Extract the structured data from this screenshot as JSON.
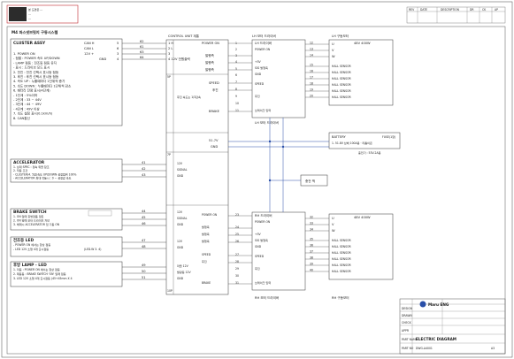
{
  "title_stamp": {
    "line1": "본 도면은 ...",
    "line2": "...",
    "line3": "..."
  },
  "page_title": "M4 파스넷브릿지 구동시스템",
  "revision_header": [
    "REV",
    "DATE",
    "DESCRIPTION",
    "DR",
    "CK",
    "AP"
  ],
  "cluster": {
    "title": "CLUSTER ASSY",
    "pins": [
      {
        "label": "CAN H",
        "pin": "5"
      },
      {
        "label": "CAN L",
        "pin": "6"
      },
      {
        "label": "12V +",
        "pin": "3"
      },
      {
        "label": "GND",
        "pin": "4"
      }
    ],
    "notes": [
      "1. POWER ON",
      "- 점멸 : POWER 속도 UP/DOWN",
      "- LAMP 점등 : 전조등 점등 유지",
      "- 표시 : 드라이브 모드 표시",
      "2. 전진 : 전진 선택시 표시등 점등",
      "3. 후진 : 후진 선택시 표시등 점등",
      "4. 속도 UP : 누를때마다 1단위씩 증가",
      "5. 속도 DOWN : 누를때마다 1단위씩 감소",
      "6. 배터리 잔량 표시(4단계)",
      "- 1단계 : 5%이하",
      "- 2단계 : 33 ~ 44V",
      "- 3단계 : 44 ~ 49V",
      "- 4단계 : 49V 이상",
      "7. 속도 설정 표시(0.1km/h)",
      "8. CAN통신"
    ]
  },
  "control_unit": {
    "title": "CONTROL UNIT 계통",
    "left_pins": [
      "1 H",
      "2 L",
      "3",
      "4 12V 전원출력",
      "5",
      "6",
      "7",
      "8",
      "9",
      "10",
      "11"
    ],
    "connector_left": [
      "62",
      "61",
      "63",
      "64"
    ],
    "motor_labels": [
      "POWER ON",
      "발행측",
      "발행측",
      "발행측",
      "SPEED",
      "후진",
      "BRAKE"
    ],
    "note": "후진 속도는 1/3감속",
    "batt_labels": [
      "51.7V",
      "GND"
    ],
    "bottom_labels": [
      "12V",
      "SIGNAL",
      "GND",
      "12V",
      "SIGNAL",
      "GND",
      "12V",
      "GND",
      "POWER ON",
      "발행측",
      "발행측",
      "발행측",
      "SPEED",
      "후진",
      "BRAKE",
      "마을 12V",
      "발광등 12V",
      "GND"
    ],
    "pin_group_a": "5P",
    "pin_group_b": "7P",
    "pin_group_c": "10P"
  },
  "lh_driver": {
    "title": "LH 모터 드라이버",
    "inner_title": "LH 드라이버",
    "rows": [
      "POWER ON",
      "+5V",
      "SIG 발행측",
      "GND",
      "SPEED",
      "후진",
      "브레이크 입력"
    ],
    "pins": [
      "1",
      "2",
      "3",
      "4",
      "5",
      "6",
      "7",
      "8",
      "9",
      "10",
      "11"
    ]
  },
  "lh_motor": {
    "title": "LH 구동모터",
    "phases": [
      {
        "pin": "12",
        "label": "U"
      },
      {
        "pin": "13",
        "label": "V"
      },
      {
        "pin": "14",
        "label": "W"
      }
    ],
    "spec": "48V 400W",
    "sensors": [
      "HALL SENSOR",
      "HALL SENSOR",
      "HALL SENSOR",
      "HALL SENSOR",
      "HALL SENSOR",
      "HALL SENSOR"
    ],
    "sensor_pins": [
      "15",
      "16",
      "17",
      "18",
      "19",
      "20"
    ]
  },
  "rh_driver": {
    "title": "RH 모터 드라이버",
    "inner_title": "RH 드라이버",
    "rows": [
      "POWER ON",
      "+5V",
      "SIG 발행측",
      "GND",
      "SPEED",
      "후진",
      "브레이크 입력"
    ],
    "pins": [
      "23",
      "24",
      "25",
      "26",
      "27",
      "28",
      "29",
      "30",
      "31"
    ]
  },
  "rh_motor": {
    "title": "RH 구동모터",
    "phases": [
      {
        "pin": "32",
        "label": "U"
      },
      {
        "pin": "33",
        "label": "V"
      },
      {
        "pin": "34",
        "label": "W"
      }
    ],
    "spec": "48V 400W",
    "sensors": [
      "HALL SENSOR",
      "HALL SENSOR",
      "HALL SENSOR",
      "HALL SENSOR",
      "HALL SENSOR",
      "HALL SENSOR"
    ],
    "sensor_pins": [
      "35",
      "36",
      "37",
      "38",
      "39",
      "40"
    ]
  },
  "battery": {
    "title": "BATTERY",
    "fuse": "FUSE(1항)",
    "desc": "1. 51.8V 납배 100A용 · 리튬이온",
    "charger": "충전기 : 53V-2A용"
  },
  "charge_port": {
    "title": "충전 잭"
  },
  "accelerator": {
    "title": "ACCELERATOR",
    "notes": [
      "1. 상대 SPEC : 정속 위을 참조",
      "2. 작동 조건",
      "- CLUSTER(4. 5항)속도 UP/DOWN 설정범위 100%",
      "- ACCELERATOR 최대 작동시 : 0 ~ 설정값 속도"
    ],
    "pins": [
      "41",
      "42",
      "43"
    ]
  },
  "brake_switch": {
    "title": "BRAKE SWITCH",
    "notes": [
      "1. ON 일때 휴방정품 정돈",
      "2. ON 일때 모터 드라이브 차단",
      "3. 해제시 ACCELERATOR 입 기동 ON"
    ],
    "pins": [
      "44",
      "45",
      "46"
    ]
  },
  "headlight": {
    "title": "전조등 LED",
    "notes": [
      "- POWER ON 에서는 항상 점등",
      "- LED 12V 소형 4개 출시점등",
      "(LED-W 3. 4)"
    ],
    "pins": [
      "47",
      "48"
    ]
  },
  "rear_lamp": {
    "title": "후방 LAMP - LED",
    "notes": [
      "1. 미등 : POWER ON 에서는 항상 점등",
      "2. 제동등 : BRAKE SWITCH 'ON' 일때 점등",
      "3. LED 12V 소형 4개 출시점등   (45+45mm X 4"
    ],
    "pins": [
      "49",
      "50",
      "51"
    ]
  },
  "title_block": {
    "company": "Maru ENG",
    "drawing_title": "ELECTRIC DIAGRAM",
    "drawing_no": "DWG-A4001",
    "scale": "A3",
    "field_labels": [
      "DESIGN",
      "DRAWN",
      "CHECK",
      "APPR",
      "PART NAME",
      "PART NO"
    ]
  },
  "colors": {
    "line": "#333333",
    "blue": "#2a4fa8",
    "red": "#c0282d",
    "frame": "#555555"
  }
}
